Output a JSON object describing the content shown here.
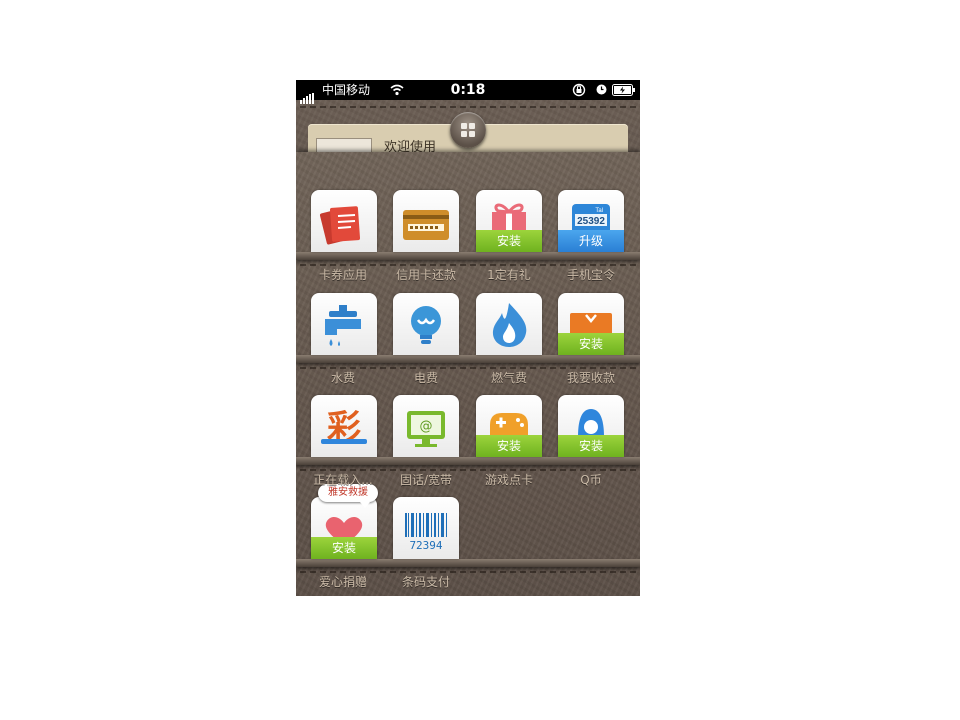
{
  "status_bar": {
    "carrier": "中国移动",
    "time": "0:18"
  },
  "welcome": {
    "text": "欢迎使用"
  },
  "apps": [
    {
      "label": "卡券应用",
      "icon": "cards-icon",
      "badge": ""
    },
    {
      "label": "信用卡还款",
      "icon": "credit-card-icon",
      "badge": ""
    },
    {
      "label": "1定有礼",
      "icon": "gift-icon",
      "badge": "安装"
    },
    {
      "label": "手机宝令",
      "icon": "token-icon",
      "badge": "升级"
    },
    {
      "label": "水费",
      "icon": "faucet-icon",
      "badge": ""
    },
    {
      "label": "电费",
      "icon": "bulb-icon",
      "badge": ""
    },
    {
      "label": "燃气费",
      "icon": "flame-icon",
      "badge": ""
    },
    {
      "label": "我要收款",
      "icon": "receive-money-icon",
      "badge": "安装"
    },
    {
      "label": "正在载入...",
      "icon": "lottery-icon",
      "badge": "",
      "glyph": "彩"
    },
    {
      "label": "固话/宽带",
      "icon": "broadband-icon",
      "badge": ""
    },
    {
      "label": "游戏点卡",
      "icon": "gamepad-icon",
      "badge": "安装"
    },
    {
      "label": "Q币",
      "icon": "qq-icon",
      "badge": "安装"
    },
    {
      "label": "爱心捐赠",
      "icon": "heart-icon",
      "badge": "安装"
    },
    {
      "label": "条码支付",
      "icon": "barcode-icon",
      "badge": "",
      "glyph": "72394"
    }
  ],
  "bubble": {
    "text": "雅安救援"
  },
  "token_icon": {
    "number": "25392",
    "small": "Tal"
  },
  "colors": {
    "install_badge": "#7fbf26",
    "upgrade_badge": "#2f86dc",
    "label_text": "#c9b9a6",
    "leather": "#65584e"
  }
}
